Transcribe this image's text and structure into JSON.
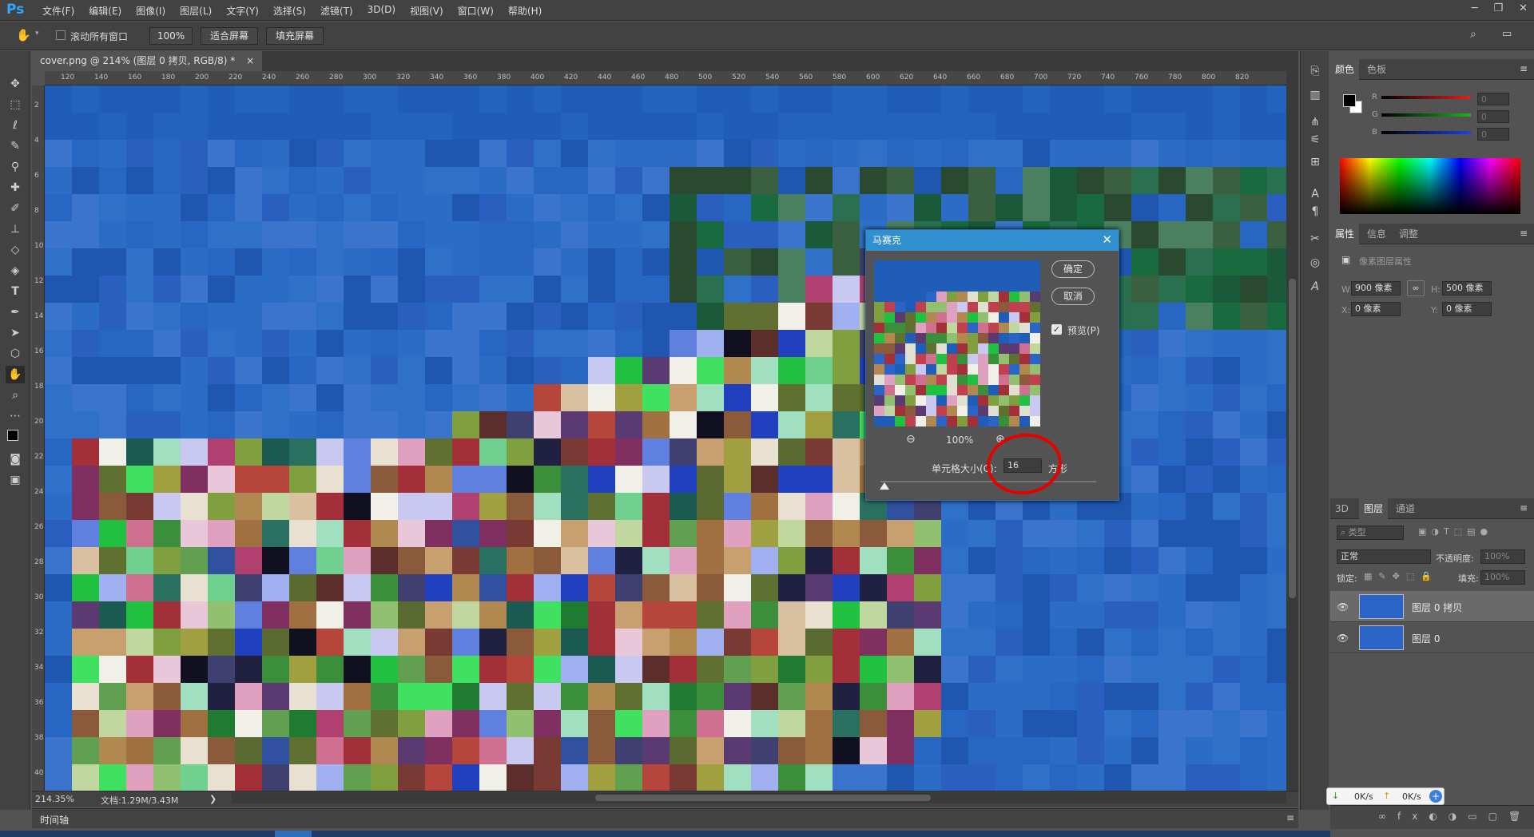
{
  "app": {
    "logo": "Ps",
    "menus": [
      "文件(F)",
      "编辑(E)",
      "图像(I)",
      "图层(L)",
      "文字(Y)",
      "选择(S)",
      "滤镜(T)",
      "3D(D)",
      "视图(V)",
      "窗口(W)",
      "帮助(H)"
    ],
    "window_controls": [
      "─",
      "❐",
      "✕"
    ]
  },
  "options_bar": {
    "scroll_all_label": "滚动所有窗口",
    "zoom_value": "100%",
    "fit_screen": "适合屏幕",
    "fill_screen": "填充屏幕"
  },
  "document": {
    "tab_title": "cover.png @ 214% (图层 0 拷贝, RGB/8) *",
    "tab_close": "×",
    "hruler_ticks": [
      "120",
      "140",
      "160",
      "180",
      "200",
      "220",
      "240",
      "260",
      "280",
      "300",
      "320",
      "340",
      "360",
      "380",
      "400",
      "420",
      "440",
      "460",
      "480",
      "500",
      "520",
      "540",
      "560",
      "580",
      "600",
      "620",
      "640",
      "660",
      "680",
      "700",
      "720",
      "740",
      "760",
      "780",
      "800",
      "820"
    ],
    "vruler_ticks": [
      "2",
      "4",
      "6",
      "8",
      "10",
      "12",
      "14",
      "16",
      "18",
      "20",
      "22",
      "24",
      "26",
      "28",
      "30",
      "32",
      "34",
      "36",
      "38",
      "40"
    ]
  },
  "status": {
    "zoom": "214.35%",
    "doc_info": "文档:1.29M/3.43M",
    "arrow": "❯"
  },
  "timeline_label": "时间轴",
  "mosaic_dialog": {
    "title": "马赛克",
    "ok": "确定",
    "cancel": "取消",
    "preview_label": "预览(P)",
    "preview_checked": true,
    "zoom": "100%",
    "cell_size_label": "单元格大小(C):",
    "cell_size_value": "16",
    "unit": "方形",
    "slider_fraction": 0.02
  },
  "color_panel": {
    "tabs": [
      "颜色",
      "色板"
    ],
    "channels": [
      {
        "label": "R",
        "value": "0",
        "color": "#e02020"
      },
      {
        "label": "G",
        "value": "0",
        "color": "#20b020"
      },
      {
        "label": "B",
        "value": "0",
        "color": "#2040e0"
      }
    ]
  },
  "properties_panel": {
    "tabs": [
      "属性",
      "信息",
      "调整"
    ],
    "header": "像素图层属性",
    "w_label": "W:",
    "w_value": "900 像素",
    "h_label": "H:",
    "h_value": "500 像素",
    "x_label": "X:",
    "x_value": "0 像素",
    "y_label": "Y:",
    "y_value": "0 像素"
  },
  "layers_panel": {
    "tabs": [
      "3D",
      "图层",
      "通道"
    ],
    "filter_kind": "类型",
    "blend_mode": "正常",
    "opacity_label": "不透明度:",
    "opacity_value": "100%",
    "lock_label": "锁定:",
    "fill_label": "填充:",
    "fill_value": "100%",
    "layers": [
      {
        "name": "图层 0 拷贝",
        "selected": true
      },
      {
        "name": "图层 0",
        "selected": false
      }
    ]
  },
  "net_widget": {
    "down": "0K/s",
    "up": "0K/s"
  },
  "colors": {
    "accent": "#31a8ff",
    "dialog_title": "#2f8fcf",
    "annotation": "#e60000"
  }
}
